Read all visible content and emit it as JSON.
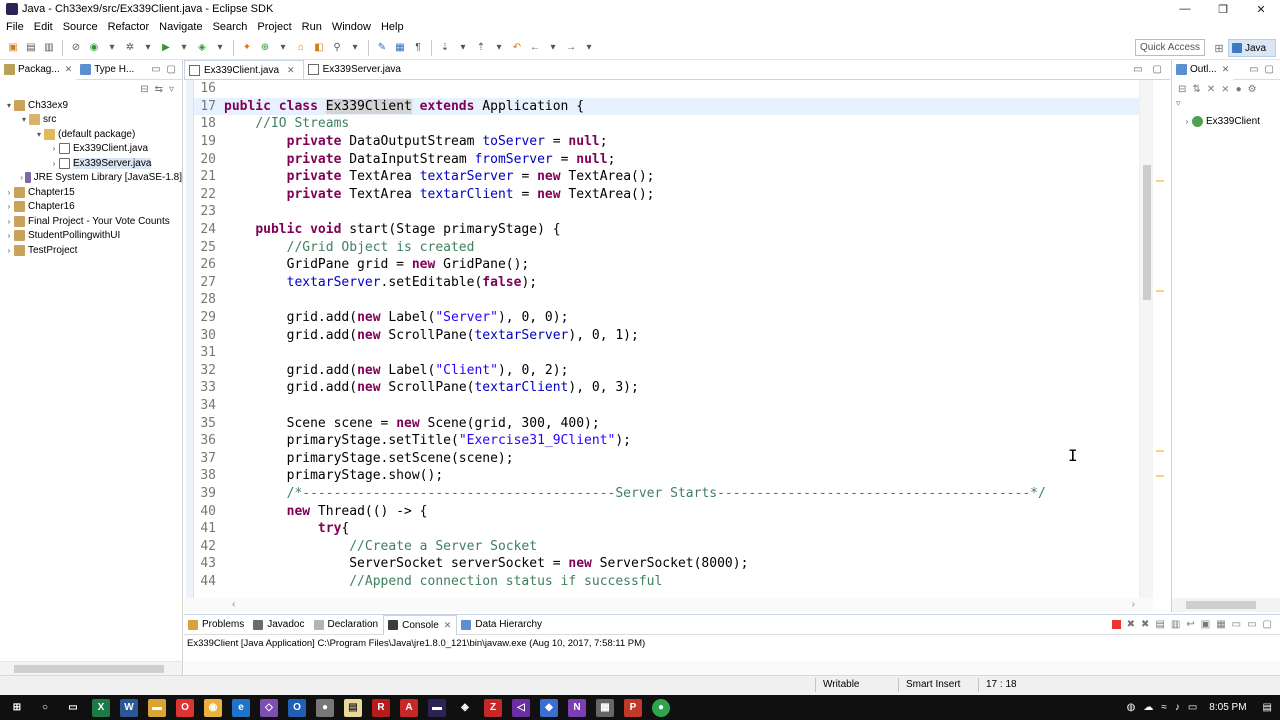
{
  "window": {
    "title": "Java - Ch33ex9/src/Ex339Client.java - Eclipse SDK",
    "minimize": "—",
    "restore": "❐",
    "close": "✕"
  },
  "menu": [
    "File",
    "Edit",
    "Source",
    "Refactor",
    "Navigate",
    "Search",
    "Project",
    "Run",
    "Window",
    "Help"
  ],
  "toolbar": {
    "quick_access": "Quick Access",
    "perspective": "Java"
  },
  "package_explorer": {
    "tab1": "Packag...",
    "tab2": "Type H...",
    "tree": [
      {
        "label": "Ch33ex9",
        "level": 0,
        "icon": "project",
        "expanded": true
      },
      {
        "label": "src",
        "level": 1,
        "icon": "source-folder",
        "expanded": true
      },
      {
        "label": "(default package)",
        "level": 2,
        "icon": "package",
        "expanded": true
      },
      {
        "label": "Ex339Client.java",
        "level": 3,
        "icon": "java-file",
        "expanded": false
      },
      {
        "label": "Ex339Server.java",
        "level": 3,
        "icon": "java-file",
        "expanded": false,
        "selected": true
      },
      {
        "label": "JRE System Library [JavaSE-1.8]",
        "level": 1,
        "icon": "library",
        "expanded": false
      },
      {
        "label": "Chapter15",
        "level": 0,
        "icon": "project",
        "expanded": false
      },
      {
        "label": "Chapter16",
        "level": 0,
        "icon": "project",
        "expanded": false
      },
      {
        "label": "Final Project - Your Vote Counts",
        "level": 0,
        "icon": "project",
        "expanded": false
      },
      {
        "label": "StudentPollingwithUI",
        "level": 0,
        "icon": "project",
        "expanded": false
      },
      {
        "label": "TestProject",
        "level": 0,
        "icon": "project",
        "expanded": false
      }
    ]
  },
  "editor": {
    "tabs": [
      {
        "label": "Ex339Client.java",
        "active": true
      },
      {
        "label": "Ex339Server.java",
        "active": false
      }
    ]
  },
  "outline": {
    "tab": "Outl...",
    "item": "Ex339Client"
  },
  "console": {
    "tabs": [
      {
        "label": "Problems",
        "active": false
      },
      {
        "label": "Javadoc",
        "active": false
      },
      {
        "label": "Declaration",
        "active": false
      },
      {
        "label": "Console",
        "active": true
      },
      {
        "label": "Data Hierarchy",
        "active": false
      }
    ],
    "description": "Ex339Client [Java Application] C:\\Program Files\\Java\\jre1.8.0_121\\bin\\javaw.exe (Aug 10, 2017, 7:58:11 PM)"
  },
  "status": {
    "writable": "Writable",
    "insert_mode": "Smart Insert",
    "position": "17 : 18"
  },
  "taskbar": {
    "time": "8:05 PM"
  }
}
